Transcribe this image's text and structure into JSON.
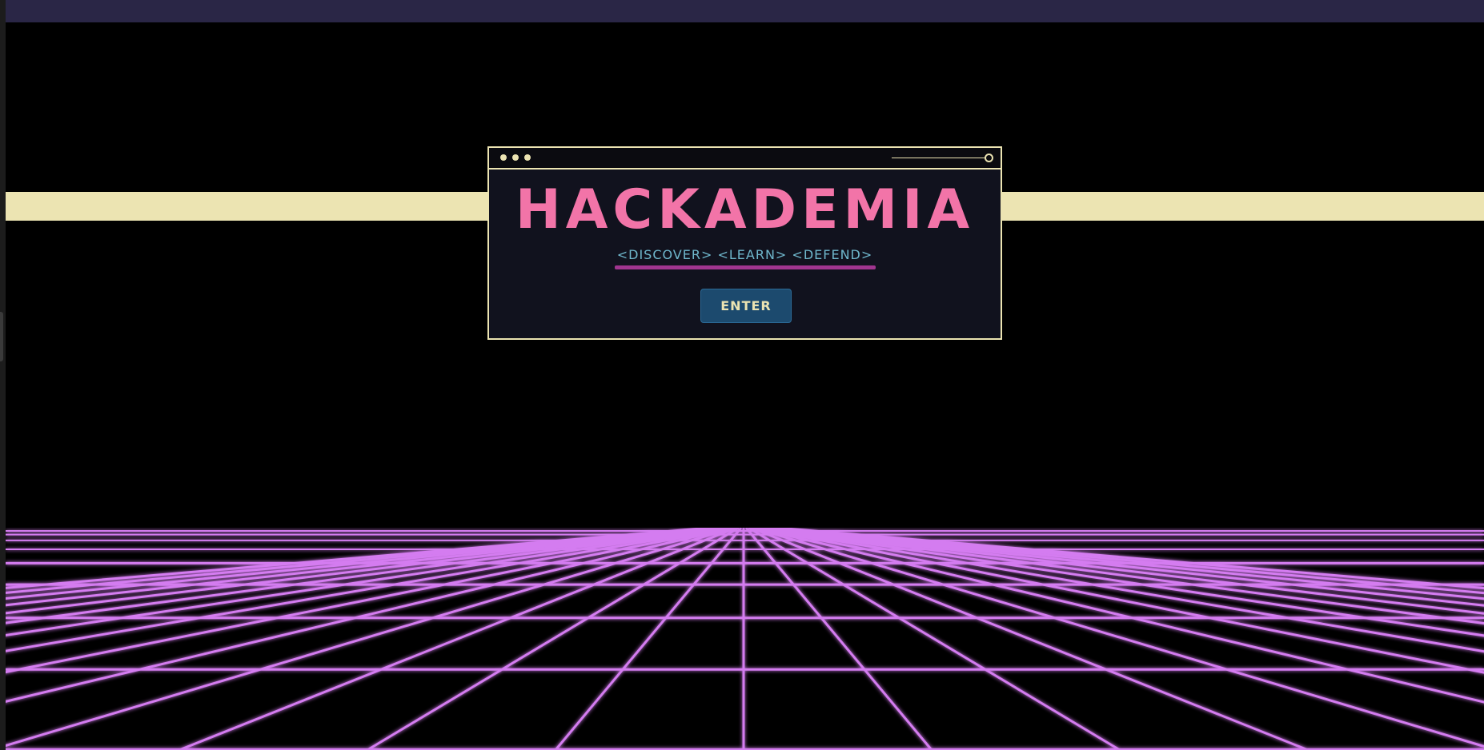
{
  "window": {
    "title": "HACKADEMIA",
    "tagline": "<DISCOVER> <LEARN> <DEFEND>",
    "enter_label": "ENTER"
  },
  "colors": {
    "background": "#000000",
    "top_bar": "#2a2646",
    "stripe": "#ece4b2",
    "window_border": "#ece4b2",
    "window_bg": "#11121e",
    "title": "#f274a8",
    "tagline": "#6fb7cc",
    "underline": "#a0358f",
    "button_bg": "#1c4a6e",
    "button_text": "#ece4b2",
    "grid": "#d47cf0"
  },
  "icons": [
    "window-dot-icon",
    "slider-knob-icon"
  ]
}
